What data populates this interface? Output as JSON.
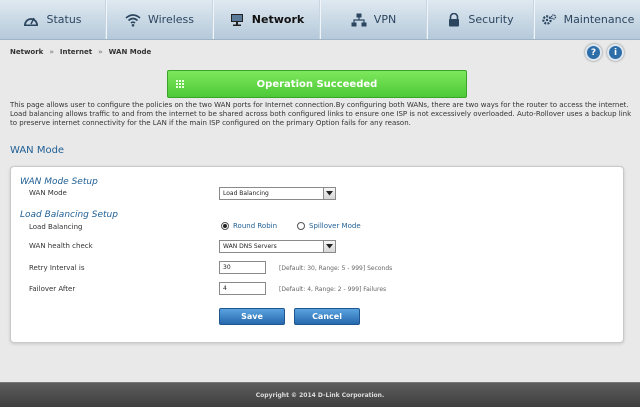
{
  "nav": {
    "tabs": [
      {
        "label": "Status",
        "icon": "gauge-icon"
      },
      {
        "label": "Wireless",
        "icon": "wifi-icon"
      },
      {
        "label": "Network",
        "icon": "monitor-icon"
      },
      {
        "label": "VPN",
        "icon": "network-icon"
      },
      {
        "label": "Security",
        "icon": "lock-icon"
      },
      {
        "label": "Maintenance",
        "icon": "gear-icon"
      }
    ],
    "active": "Network"
  },
  "breadcrumb": [
    "Network",
    "Internet",
    "WAN Mode"
  ],
  "breadcrumb_sep": "»",
  "help": {
    "question": "?",
    "info": "i"
  },
  "banner": {
    "text": "Operation Succeeded",
    "color": "#4cc936"
  },
  "description": "This page allows user to configure the policies on the two WAN ports for Internet connection.By configuring both WANs, there are two ways for the router to access the internet. Load balancing allows traffic to and from the internet to be shared across both configured links to ensure one ISP is not excessively overloaded. Auto-Rollover uses a backup link to preserve internet connectivity for the LAN if the main ISP configured on the primary Option fails for any reason.",
  "section_title": "WAN Mode",
  "wan_setup": {
    "title": "WAN Mode Setup",
    "mode_label": "WAN Mode",
    "mode_value": "Load Balancing"
  },
  "lb_setup": {
    "title": "Load Balancing Setup",
    "lb_label": "Load Balancing",
    "option_round_robin": "Round Robin",
    "option_spillover": "Spillover Mode",
    "selected": "Round Robin",
    "health_label": "WAN health check",
    "health_value": "WAN DNS Servers",
    "retry_label": "Retry Interval is",
    "retry_value": "30",
    "retry_hint": "[Default: 30, Range: 5 - 999] Seconds",
    "failover_label": "Failover After",
    "failover_value": "4",
    "failover_hint": "[Default: 4, Range: 2 - 999] Failures"
  },
  "buttons": {
    "save": "Save",
    "cancel": "Cancel"
  },
  "footer": "Copyright © 2014 D-Link Corporation.",
  "colors": {
    "accent": "#1f5f94",
    "button": "#2669ad",
    "success": "#4cc936"
  }
}
